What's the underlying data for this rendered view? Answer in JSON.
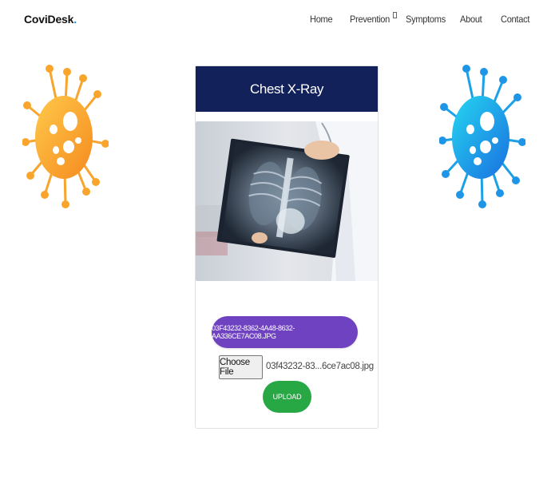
{
  "brand": {
    "name": "CoviDesk",
    "dot": "."
  },
  "nav": {
    "items": [
      {
        "label": "Home"
      },
      {
        "label": "Prevention"
      },
      {
        "label": "Symptoms"
      },
      {
        "label": "About"
      },
      {
        "label": "Contact"
      }
    ]
  },
  "card": {
    "title": "Chest X-Ray",
    "selected_file_button": "03F43232-8362-4A48-8632-AA336CE7AC08.JPG",
    "choose_file_label": "Choose File",
    "chosen_file_name": "03f43232-83...6ce7ac08.jpg",
    "upload_label": "UPLOAD"
  },
  "colors": {
    "header_bg": "#13215a",
    "purple_button": "#6f42c1",
    "green_button": "#28a745",
    "virus_left": "#f5a623",
    "virus_right": "#1e9be8"
  },
  "icons": {
    "left_decoration": "virus-icon",
    "right_decoration": "virus-icon"
  }
}
